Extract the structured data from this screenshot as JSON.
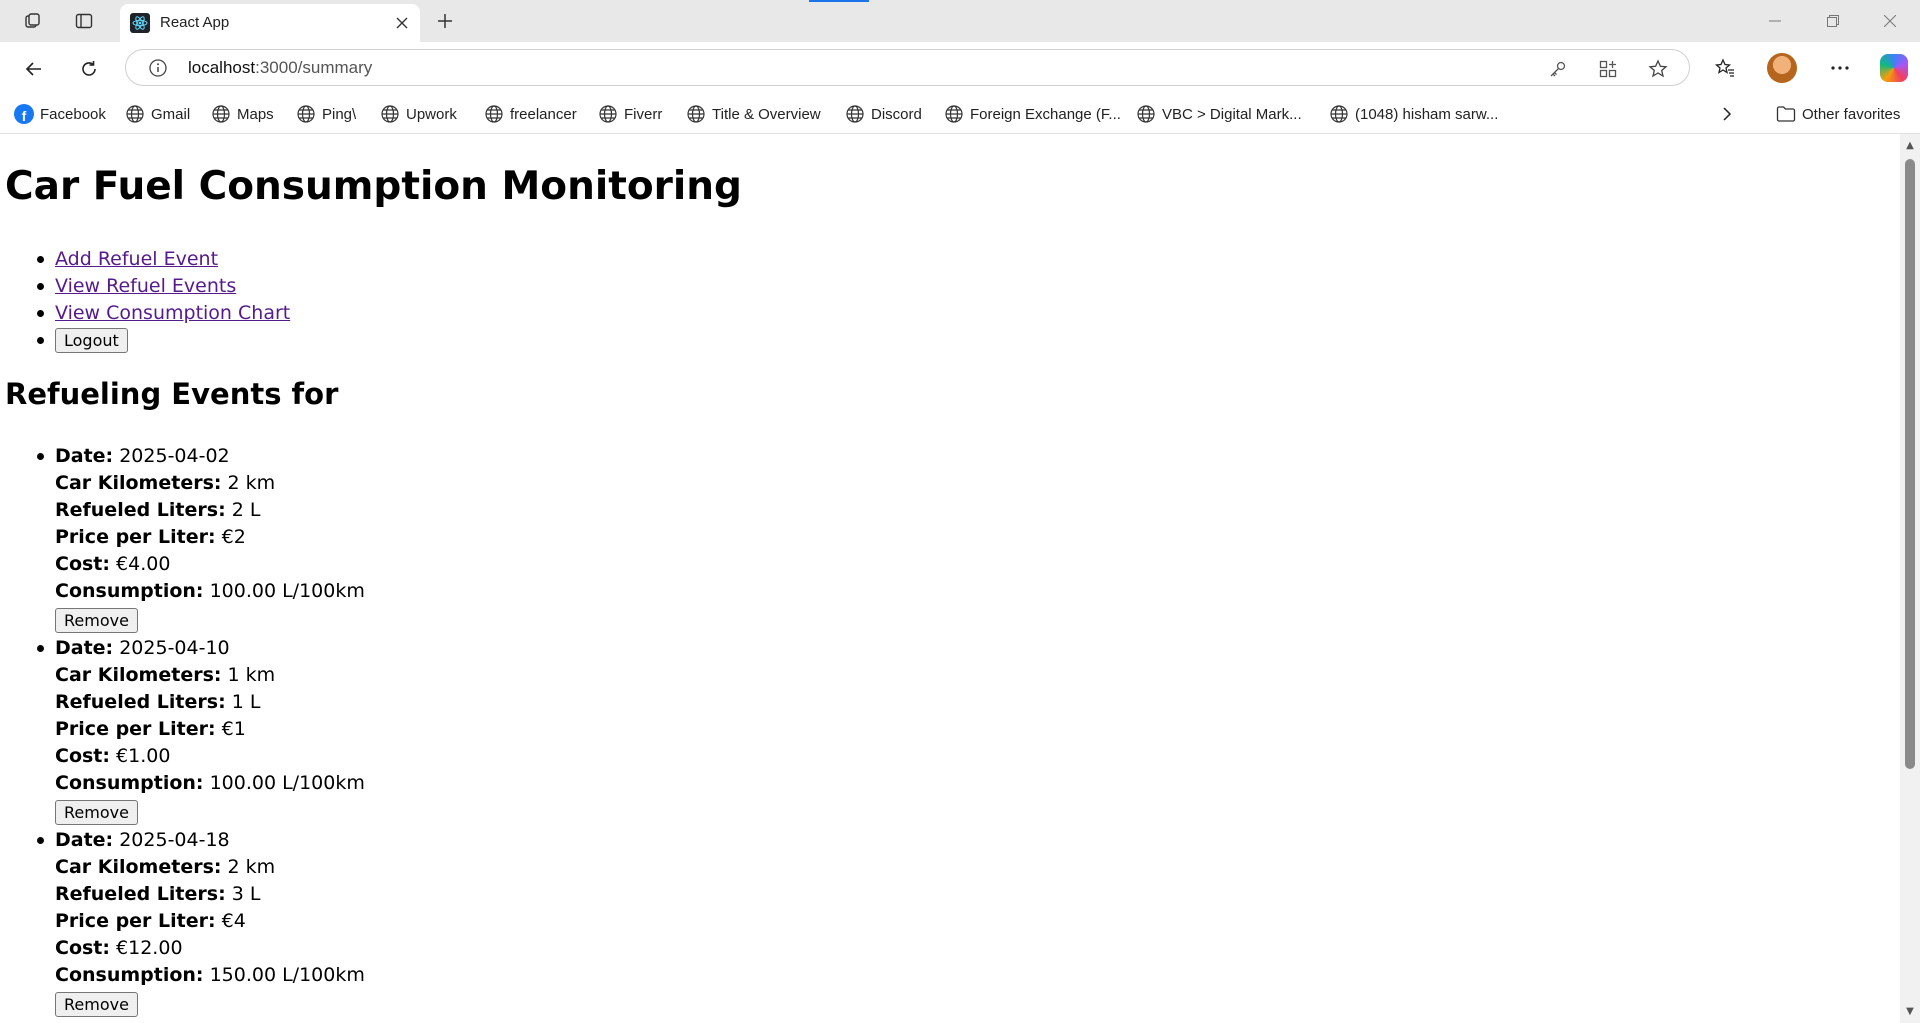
{
  "browser": {
    "tab_title": "React App",
    "url_host": "localhost",
    "url_path": ":3000/summary",
    "bookmarks": [
      {
        "label": "Facebook",
        "icon": "facebook-icon"
      },
      {
        "label": "Gmail",
        "icon": "globe-icon"
      },
      {
        "label": "Maps",
        "icon": "globe-icon"
      },
      {
        "label": "Ping\\",
        "icon": "globe-icon"
      },
      {
        "label": "Upwork",
        "icon": "globe-icon"
      },
      {
        "label": "freelancer",
        "icon": "globe-icon"
      },
      {
        "label": "Fiverr",
        "icon": "globe-icon"
      },
      {
        "label": "Title & Overview",
        "icon": "globe-icon"
      },
      {
        "label": "Discord",
        "icon": "globe-icon"
      },
      {
        "label": "Foreign Exchange (F...",
        "icon": "globe-icon"
      },
      {
        "label": "VBC > Digital Mark...",
        "icon": "globe-icon"
      },
      {
        "label": "(1048) hisham sarw...",
        "icon": "globe-icon"
      }
    ],
    "other_favorites": "Other favorites"
  },
  "page": {
    "title": "Car Fuel Consumption Monitoring",
    "nav": {
      "add": "Add Refuel Event",
      "view": "View Refuel Events",
      "chart": "View Consumption Chart",
      "logout": "Logout"
    },
    "section_title": "Refueling Events for",
    "labels": {
      "date": "Date:",
      "km": "Car Kilometers:",
      "liters": "Refueled Liters:",
      "price": "Price per Liter:",
      "cost": "Cost:",
      "consumption": "Consumption:",
      "remove": "Remove"
    },
    "events": [
      {
        "date": "2025-04-02",
        "km": "2 km",
        "liters": "2 L",
        "price": "€2",
        "cost": "€4.00",
        "consumption": "100.00 L/100km"
      },
      {
        "date": "2025-04-10",
        "km": "1 km",
        "liters": "1 L",
        "price": "€1",
        "cost": "€1.00",
        "consumption": "100.00 L/100km"
      },
      {
        "date": "2025-04-18",
        "km": "2 km",
        "liters": "3 L",
        "price": "€4",
        "cost": "€12.00",
        "consumption": "150.00 L/100km"
      }
    ]
  },
  "colors": {
    "link_visited": "#551a8b",
    "accent": "#1a73e8"
  }
}
